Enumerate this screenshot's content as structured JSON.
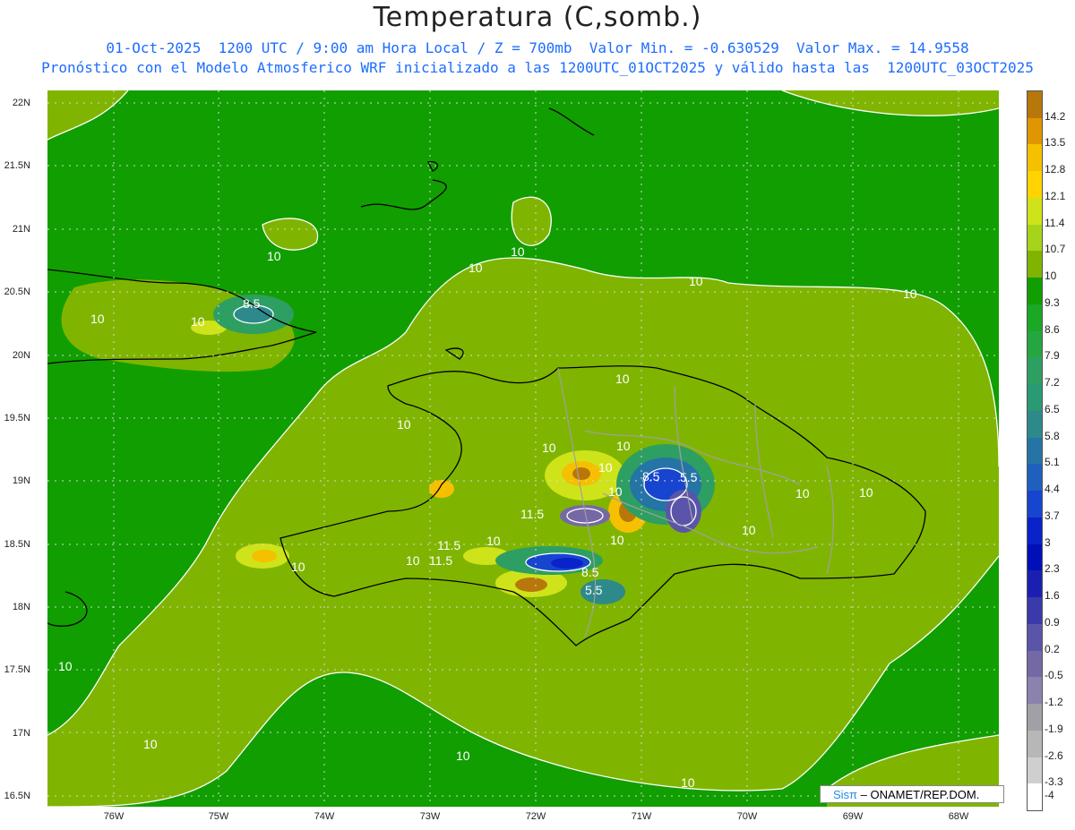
{
  "header": {
    "title": "Temperatura (C,somb.)",
    "line1": "01-Oct-2025  1200 UTC / 9:00 am Hora Local / Z = 700mb  Valor Min. = -0.630529  Valor Max. = 14.9558",
    "line2": "Pronóstico con el Modelo Atmosferico WRF inicializado a las 1200UTC_01OCT2025 y válido hasta las  1200UTC_03OCT2025"
  },
  "axes": {
    "lat_labels": [
      "22N",
      "21.5N",
      "21N",
      "20.5N",
      "20N",
      "19.5N",
      "19N",
      "18.5N",
      "18N",
      "17.5N",
      "17N",
      "16.5N"
    ],
    "lon_labels": [
      "76W",
      "75W",
      "74W",
      "73W",
      "72W",
      "71W",
      "70W",
      "69W",
      "68W"
    ]
  },
  "contour_labels": [
    "10",
    "10",
    "10",
    "10",
    "10",
    "10",
    "8.5",
    "10",
    "10",
    "10",
    "10",
    "10",
    "10",
    "8.5",
    "5.5",
    "10",
    "11.5",
    "11.5",
    "10",
    "10",
    "10",
    "11.5",
    "10",
    "10",
    "8.5",
    "5.5",
    "10",
    "10",
    "10"
  ],
  "colorbar": {
    "labels": [
      "14.2",
      "13.5",
      "12.8",
      "12.1",
      "11.4",
      "10.7",
      "10",
      "9.3",
      "8.6",
      "7.9",
      "7.2",
      "6.5",
      "5.8",
      "5.1",
      "4.4",
      "3.7",
      "3",
      "2.3",
      "1.6",
      "0.9",
      "0.2",
      "-0.5",
      "-1.2",
      "-1.9",
      "-2.6",
      "-3.3",
      "-4"
    ],
    "colors": [
      "#b8770a",
      "#e09600",
      "#f5c000",
      "#ffd400",
      "#cfe31a",
      "#a6d41a",
      "#7fb500",
      "#119e00",
      "#1aa825",
      "#26a640",
      "#2e9f62",
      "#2a9a75",
      "#2e8a8a",
      "#2574a6",
      "#1f60bf",
      "#1745cf",
      "#0a22c9",
      "#0010b8",
      "#1a1fb0",
      "#3a3aaa",
      "#5a55a8",
      "#7569a5",
      "#8b82ad",
      "#a0a0a6",
      "#b7b7b7",
      "#cfcfcf",
      "#ffffff"
    ]
  },
  "credit": {
    "brand": "Sisπ",
    "rest": " – ONAMET/REP.DOM."
  }
}
